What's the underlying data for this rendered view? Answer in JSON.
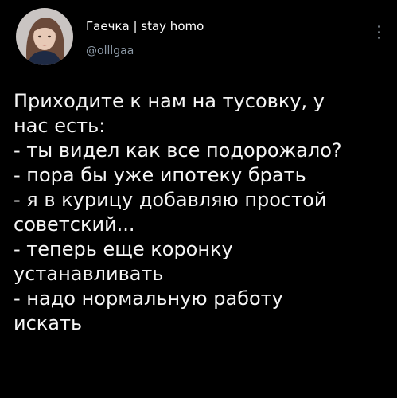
{
  "tweet": {
    "author": {
      "display_name": "Гаечка | stay homo",
      "handle": "@olllgaa",
      "avatar_icon": "user-avatar-photo"
    },
    "more_icon": "more-vertical-icon",
    "text_lines": [
      "Приходите к нам на тусовку, у",
      "нас есть:",
      "- ты видел как все подорожало?",
      "- пора бы уже ипотеку брать",
      "- я в курицу добавляю простой",
      "советский...",
      "- теперь еще коронку",
      "устанавливать",
      "- надо нормальную работу",
      "искать"
    ]
  },
  "colors": {
    "background": "#000000",
    "text": "#f5f5f5",
    "secondary_text": "#8b98a5"
  }
}
